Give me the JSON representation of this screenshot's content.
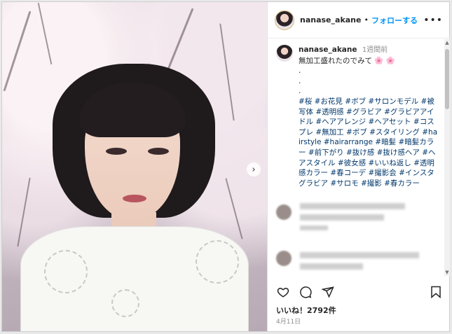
{
  "post": {
    "username": "nanase_akane",
    "separator": "•",
    "follow_label": "フォローする",
    "more_label": "•••"
  },
  "caption": {
    "username": "nanase_akane",
    "time": "1週間前",
    "line1": "無加工盛れたのでみて 🌸 🌸",
    "dots": [
      ".",
      ".",
      "."
    ],
    "hashtags": "#桜 #お花見 #ボブ #サロンモデル #被写体 #透明感 #グラビア #グラビアアイドル #ヘアアレンジ #ヘアセット #コスプレ #無加工 #ボブ #スタイリング #hairstyle #hairarrange #暗髪 #暗髪カラー #前下がり #抜け感 #抜け感ヘア #ヘアスタイル #彼女感 #いいね返し #透明感カラー #春コーデ #撮影会 #インスタグラビア #サロモ #撮影 #春カラー"
  },
  "icons": {
    "heart": "heart-icon",
    "comment": "comment-icon",
    "share": "share-icon",
    "bookmark": "bookmark-icon",
    "next": "chevron-right-icon"
  },
  "likes_text": "いいね！2792件",
  "date_text": "4月11日",
  "colors": {
    "link": "#0095f6",
    "hashtag": "#00376b",
    "text": "#262626",
    "muted": "#8e8e8e"
  }
}
